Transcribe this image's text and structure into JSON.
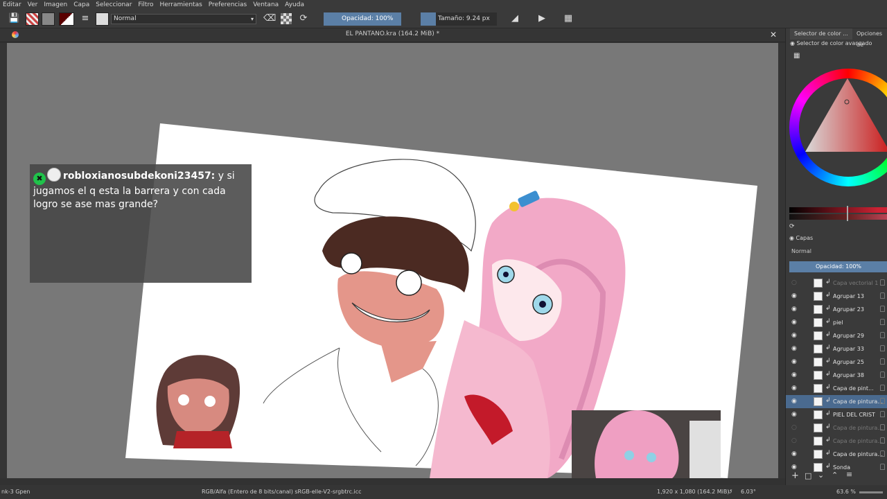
{
  "menubar": {
    "items": [
      "Editar",
      "Ver",
      "Imagen",
      "Capa",
      "Seleccionar",
      "Filtro",
      "Herramientas",
      "Preferencias",
      "Ventana",
      "Ayuda"
    ]
  },
  "toolbar": {
    "blend_mode": "Normal",
    "opacity_label": "Opacidad: 100%",
    "size_label": "Tamaño: 9.24 px",
    "opacity_fraction": 1.0
  },
  "document": {
    "title": "EL PANTANO.kra (164.2 MiB) *"
  },
  "chat": {
    "username": "robloxianosubdekoni23457:",
    "message": "y si jugamos el q esta la barrera y con cada logro se ase mas grande?"
  },
  "docker": {
    "tab_color": "Selector de color ...",
    "tab_options": "Opciones de",
    "color_panel_title": "Selector de color avanzado",
    "layers_title": "Capas",
    "layers_blend": "Normal",
    "layers_opacity": "Opacidad:  100%",
    "layers": [
      {
        "name": "Capa vectorial 1",
        "visible": false,
        "dim": true
      },
      {
        "name": "Agrupar 13",
        "visible": true,
        "dim": false
      },
      {
        "name": "Agrupar 23",
        "visible": true,
        "dim": false
      },
      {
        "name": "piel",
        "visible": true,
        "dim": false
      },
      {
        "name": "Agrupar 29",
        "visible": true,
        "dim": false
      },
      {
        "name": "Agrupar 33",
        "visible": true,
        "dim": false
      },
      {
        "name": "Agrupar 25",
        "visible": true,
        "dim": false
      },
      {
        "name": "Agrupar 38",
        "visible": true,
        "dim": false
      },
      {
        "name": "Capa de pint...",
        "visible": true,
        "dim": false
      },
      {
        "name": "Capa de pintura...",
        "visible": true,
        "dim": false,
        "selected": true
      },
      {
        "name": "PIEL DEL CRIST",
        "visible": true,
        "dim": false
      },
      {
        "name": "Capa de pintura...",
        "visible": false,
        "dim": true
      },
      {
        "name": "Capa de pintura...",
        "visible": false,
        "dim": true
      },
      {
        "name": "Capa de pintura...",
        "visible": true,
        "dim": false
      },
      {
        "name": "Sonda",
        "visible": true,
        "dim": false
      }
    ]
  },
  "status": {
    "left": "nk-3 Gpen",
    "color_space": "RGB/Alfa (Entero de 8 bits/canal)  sRGB-elle-V2-srgbtrc.icc",
    "dimensions": "1,920 x 1,080 (164.2 MiB)",
    "rotation": "6.03°",
    "zoom": "63.6 %"
  },
  "colors": {
    "accent": "#5b7fa6",
    "canvas_bg": "#787878",
    "ui_bg": "#3a3a3a",
    "chat_badge": "#1fc24a"
  }
}
